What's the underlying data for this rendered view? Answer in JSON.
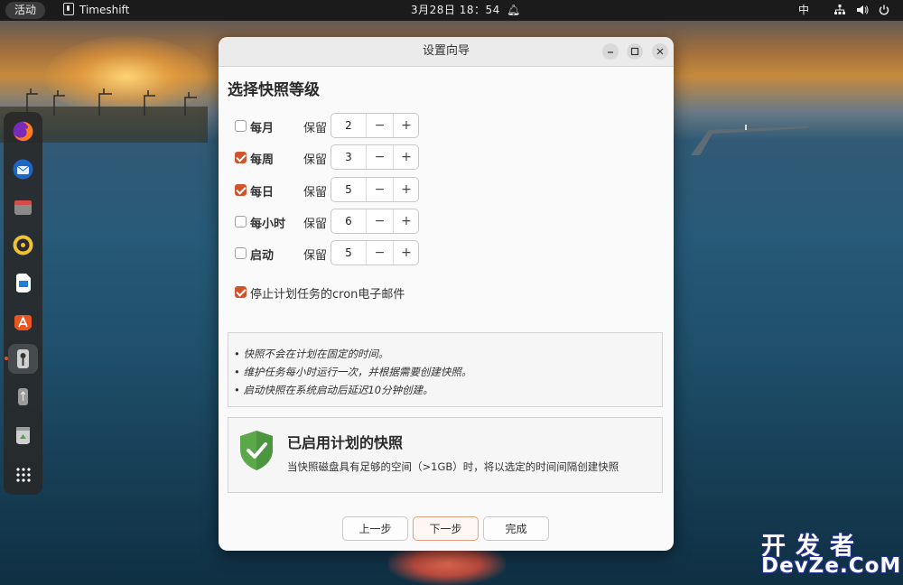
{
  "topbar": {
    "activities": "活动",
    "app_name": "Timeshift",
    "clock": "3月28日  18：54",
    "ime": "中"
  },
  "dock": {
    "items": [
      {
        "icon": "firefox-icon",
        "color": "#e66000"
      },
      {
        "icon": "thunderbird-icon",
        "color": "#2a7bd8"
      },
      {
        "icon": "files-icon",
        "color": "#d64a4a"
      },
      {
        "icon": "rhythmbox-icon",
        "color": "#e2a10a"
      },
      {
        "icon": "writer-icon",
        "color": "#1e7fd8"
      },
      {
        "icon": "app-center-icon",
        "color": "#e95420"
      },
      {
        "icon": "timeshift-icon",
        "color": "#cccccc",
        "active": true
      },
      {
        "icon": "usb-drive-icon",
        "color": "#9a9a9a"
      },
      {
        "icon": "trash-icon",
        "color": "#7ab648"
      },
      {
        "icon": "show-apps-icon",
        "color": "#ffffff"
      }
    ]
  },
  "dialog": {
    "title": "设置向导",
    "section_title": "选择快照等级",
    "keep_label": "保留",
    "levels": [
      {
        "label": "每月",
        "checked": false,
        "value": "2"
      },
      {
        "label": "每周",
        "checked": true,
        "value": "3"
      },
      {
        "label": "每日",
        "checked": true,
        "value": "5"
      },
      {
        "label": "每小时",
        "checked": false,
        "value": "6"
      },
      {
        "label": "启动",
        "checked": false,
        "value": "5"
      }
    ],
    "spin_minus": "−",
    "spin_plus": "+",
    "cron_label": "停止计划任务的cron电子邮件",
    "cron_checked": true,
    "notes": [
      "• 快照不会在计划在固定的时间。",
      "• 维护任务每小时运行一次，并根据需要创建快照。",
      "• 启动快照在系统启动后延迟10分钟创建。"
    ],
    "status_title": "已启用计划的快照",
    "status_desc": "当快照磁盘具有足够的空间（>1GB）时，将以选定的时间间隔创建快照",
    "buttons": {
      "prev": "上一步",
      "next": "下一步",
      "finish": "完成"
    }
  },
  "watermark": {
    "line1": "开发者",
    "line2": "DevZe.CoM"
  },
  "colors": {
    "accent": "#d0552c",
    "shield": "#5aa84a"
  }
}
